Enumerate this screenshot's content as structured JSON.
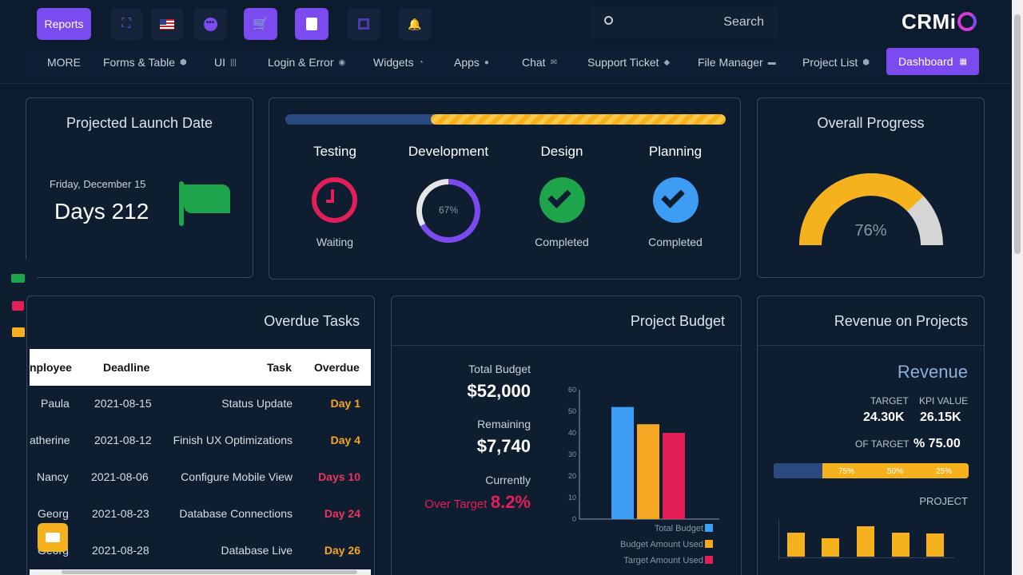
{
  "topbar": {
    "reports_label": "Reports",
    "search_placeholder": "Search",
    "logo_text": "CRMi"
  },
  "nav": {
    "items": [
      "MORE",
      "Forms & Table",
      "UI",
      "Login & Error",
      "Widgets",
      "Apps",
      "Chat",
      "Support Ticket",
      "File Manager",
      "Project List"
    ],
    "dashboard": "Dashboard"
  },
  "launch": {
    "title": "Projected Launch Date",
    "date": "Friday, December 15",
    "days": "Days 212"
  },
  "stages": {
    "items": [
      {
        "name": "Testing",
        "status": "Waiting"
      },
      {
        "name": "Development",
        "percent": "67%"
      },
      {
        "name": "Design",
        "status": "Completed"
      },
      {
        "name": "Planning",
        "status": "Completed"
      }
    ]
  },
  "overall": {
    "title": "Overall Progress",
    "percent": "76%",
    "value": 0.76
  },
  "overdue": {
    "title": "Overdue Tasks",
    "headers": [
      "nployee",
      "Deadline",
      "Task",
      "Overdue"
    ],
    "rows": [
      {
        "employee": "Paula",
        "deadline": "2021-08-15",
        "task": "Status Update",
        "overdue": "Day 1",
        "color": "#f5a623"
      },
      {
        "employee": "atherine",
        "deadline": "2021-08-12",
        "task": "Finish UX Optimizations",
        "overdue": "Day 4",
        "color": "#f5a623"
      },
      {
        "employee": "Nancy",
        "deadline": "2021-08-06",
        "task": "Configure Mobile View",
        "overdue": "Days 10",
        "color": "#e8365d"
      },
      {
        "employee": "Georg",
        "deadline": "2021-08-23",
        "task": "Database Connections",
        "overdue": "Day 24",
        "color": "#e8365d"
      },
      {
        "employee": "Georg",
        "deadline": "2021-08-28",
        "task": "Database Live",
        "overdue": "Day 26",
        "color": "#f5a623"
      }
    ]
  },
  "budget": {
    "title": "Project Budget",
    "total_label": "Total Budget",
    "total_value": "$52,000",
    "remaining_label": "Remaining",
    "remaining_value": "$7,740",
    "currently_label": "Currently",
    "over_label": "Over Target",
    "over_value": "8.2%"
  },
  "chart_data": {
    "type": "bar",
    "categories": [
      "Total Budget",
      "Budget Amount Used",
      "Target Amount Used"
    ],
    "values": [
      52,
      44,
      40
    ],
    "colors": [
      "#3d9df5",
      "#f5a623",
      "#e31f5a"
    ],
    "yticks": [
      "0",
      "10",
      "20",
      "30",
      "40",
      "50",
      "60"
    ],
    "ylim": [
      0,
      60
    ],
    "legend": "bottom-right"
  },
  "revenue": {
    "title": "Revenue on Projects",
    "heading": "Revenue",
    "target_label": "TARGET",
    "target_value": "24.30K",
    "kpi_label": "KPI VALUE",
    "kpi_value": "26.15K",
    "of_target_label": "OF TARGET",
    "of_target_value": "% 75.00",
    "bar_labels": [
      "75%",
      "50%",
      "25%"
    ],
    "project_label": "PROJECT"
  }
}
